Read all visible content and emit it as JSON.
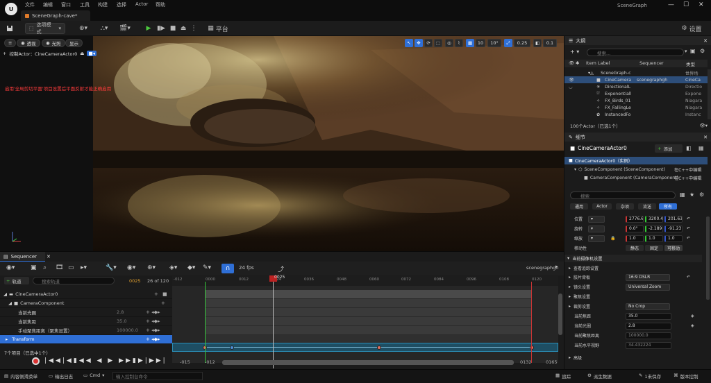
{
  "titlebar": {
    "logo": "U",
    "menu": [
      "文件",
      "编辑",
      "窗口",
      "工具",
      "构建",
      "选择",
      "Actor",
      "帮助"
    ],
    "doc_tab": "SceneGraph-cave*",
    "app_name": "SceneGraph",
    "min": "—",
    "max": "☐",
    "close": "✕"
  },
  "toolbar": {
    "save_icon": "save-icon",
    "mode": "选项模式",
    "platform": "平台",
    "settings": "设置"
  },
  "viewport": {
    "perspective": "透视",
    "lit": "光照",
    "show": "显示",
    "actor_label": "控制Actor：CineCameraActor0",
    "warning": "启用'全局剪切平面'项目设置后平面反射才能正确启用",
    "grid_value": "10",
    "angle_value": "10°",
    "scale_value": "0.25",
    "cam_speed": "0.1"
  },
  "sequencer": {
    "tab": "Sequencer",
    "fps": "24 fps",
    "sequence_name": "scenegraphgh",
    "add_track": "轨道",
    "search_placeholder": "搜索轨道",
    "frame_current": "0025",
    "frame_of": "26 of 120",
    "ruler": [
      "-012",
      "0000",
      "0012",
      "0024",
      "0036",
      "0048",
      "0060",
      "0072",
      "0084",
      "0096",
      "0108",
      "0120"
    ],
    "playhead": "0025",
    "tracks": [
      {
        "label": "CineCameraActor0",
        "value": ""
      },
      {
        "label": "CameraComponent",
        "value": ""
      },
      {
        "label": "当前光圈",
        "value": "2.8"
      },
      {
        "label": "当前焦距",
        "value": "35.0"
      },
      {
        "label": "手动聚焦距离（聚焦设置）",
        "value": "100000.0"
      },
      {
        "label": "Transform",
        "value": ""
      }
    ],
    "status": "7个项目（已选中1个）",
    "range_left_outer": "-015",
    "range_left_inner": "-012",
    "range_right_inner": "0132",
    "range_right_outer": "0165"
  },
  "outliner": {
    "tab": "大纲",
    "search_placeholder": "搜索...",
    "col_label": "Item Label",
    "col_seq": "Sequencer",
    "col_type": "类型",
    "rows": [
      {
        "label": "SceneGraph-c",
        "seq": "",
        "type": "世界场"
      },
      {
        "label": "CineCamera",
        "seq": "scenegraphgh",
        "type": "CineCa"
      },
      {
        "label": "DirectionalL",
        "seq": "",
        "type": "Directio"
      },
      {
        "label": "Exponentiall",
        "seq": "",
        "type": "Expone"
      },
      {
        "label": "FX_Birds_01",
        "seq": "",
        "type": "Niagara"
      },
      {
        "label": "FX_FallingLe",
        "seq": "",
        "type": "Niagara"
      },
      {
        "label": "InstancedFo",
        "seq": "",
        "type": "Instanc"
      }
    ],
    "count": "100个Actor（已选1个）"
  },
  "details": {
    "tab": "细节",
    "actor_name": "CineCameraActor0",
    "add": "添加",
    "instance": "CineCameraActor0（实例）",
    "components": [
      {
        "label": "SceneComponent (SceneComponent)",
        "hint": "在C++中编辑"
      },
      {
        "label": "CameraComponent (CameraComponent)",
        "hint": "在C++中编辑"
      }
    ],
    "search_placeholder": "搜索",
    "filters": [
      "通用",
      "Actor",
      "杂项",
      "流送",
      "所有"
    ],
    "loc_label": "位置",
    "loc": [
      "2776.6",
      "3200.4",
      "201.63"
    ],
    "rot_label": "旋转",
    "rot": [
      "0.0°",
      "-2.189",
      "-91.23"
    ],
    "scale_label": "缩放",
    "scale": [
      "1.0",
      "1.0",
      "1.0"
    ],
    "mobility_label": "移动性",
    "mobility": [
      "静态",
      "固定",
      "可移动"
    ],
    "sections": {
      "current_camera": "当前摄像机设置",
      "lookat": "查看追踪设置",
      "filmback": "胶片背板",
      "lens": "镜头设置",
      "focus": "聚焦设置",
      "crop": "裁剪设置"
    },
    "filmback_value": "16:9 DSLR",
    "lens_value": "Universal Zoom",
    "crop_value": "No Crop",
    "focal_label": "当前焦距",
    "focal": "35.0",
    "aperture_label": "当前光圈",
    "aperture": "2.8",
    "focus_dist_label": "当前聚焦距离",
    "focus_dist": "100000.0",
    "hfov_label": "当前水平视野",
    "hfov": "34.432224",
    "advanced": "高级"
  },
  "statusbar": {
    "content_drawer": "内容侧滑菜单",
    "output_log": "输出日志",
    "cmd": "Cmd",
    "cmd_placeholder": "输入控制台命令",
    "trace": "追踪",
    "derived": "派生数据",
    "unsaved": "1未保存",
    "revision": "版本控制"
  }
}
